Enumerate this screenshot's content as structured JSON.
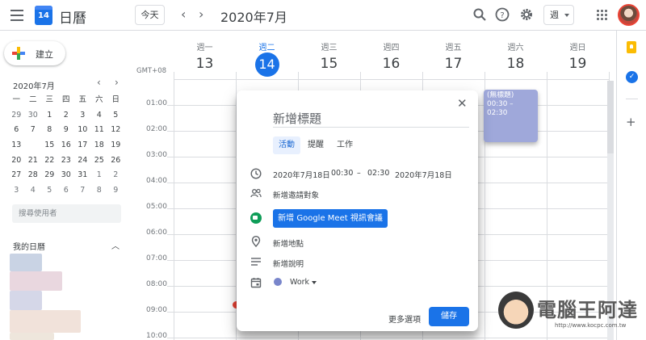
{
  "header": {
    "app_title": "日曆",
    "logo_day": "14",
    "today_label": "今天",
    "prev_icon": "‹",
    "next_icon": "›",
    "current_month": "2020年7月",
    "view_label": "週"
  },
  "sidebar": {
    "create_label": "建立",
    "mini_month": "2020年7月",
    "weekday_heads": [
      "一",
      "二",
      "三",
      "四",
      "五",
      "六",
      "日"
    ],
    "mini_weeks": [
      [
        "29",
        "30",
        "1",
        "2",
        "3",
        "4",
        "5"
      ],
      [
        "6",
        "7",
        "8",
        "9",
        "10",
        "11",
        "12"
      ],
      [
        "13",
        "14",
        "15",
        "16",
        "17",
        "18",
        "19"
      ],
      [
        "20",
        "21",
        "22",
        "23",
        "24",
        "25",
        "26"
      ],
      [
        "27",
        "28",
        "29",
        "30",
        "31",
        "1",
        "2"
      ],
      [
        "3",
        "4",
        "5",
        "6",
        "7",
        "8",
        "9"
      ]
    ],
    "search_people_placeholder": "搜尋使用者",
    "my_calendars_title": "我的日曆"
  },
  "calendar": {
    "timezone": "GMT+08",
    "days": [
      {
        "dow": "週一",
        "num": "13",
        "current": false
      },
      {
        "dow": "週二",
        "num": "14",
        "current": true
      },
      {
        "dow": "週三",
        "num": "15",
        "current": false
      },
      {
        "dow": "週四",
        "num": "16",
        "current": false
      },
      {
        "dow": "週五",
        "num": "17",
        "current": false
      },
      {
        "dow": "週六",
        "num": "18",
        "current": false
      },
      {
        "dow": "週日",
        "num": "19",
        "current": false
      }
    ],
    "hours": [
      "01:00",
      "02:00",
      "03:00",
      "04:00",
      "05:00",
      "06:00",
      "07:00",
      "08:00",
      "09:00",
      "10:00"
    ],
    "event": {
      "title": "(無標題)",
      "time": "00:30 – 02:30"
    }
  },
  "dialog": {
    "title_placeholder": "新增標題",
    "tabs": [
      "活動",
      "提醒",
      "工作"
    ],
    "start_date": "2020年7月18日",
    "start_time": "00:30",
    "dash": "–",
    "end_time": "02:30",
    "end_date": "2020年7月18日",
    "guests": "新增邀請對象",
    "meet_button": "新增 Google Meet 視訊會議",
    "location": "新增地點",
    "description": "新增說明",
    "calendar_name": "Work",
    "more_options": "更多選項",
    "save": "儲存"
  },
  "watermark": {
    "text": "電腦王阿達",
    "url": "http://www.kocpc.com.tw"
  },
  "colors": {
    "accent": "#1a73e8",
    "event": "#9fa8da",
    "calendar_dot": "#7986cb"
  }
}
